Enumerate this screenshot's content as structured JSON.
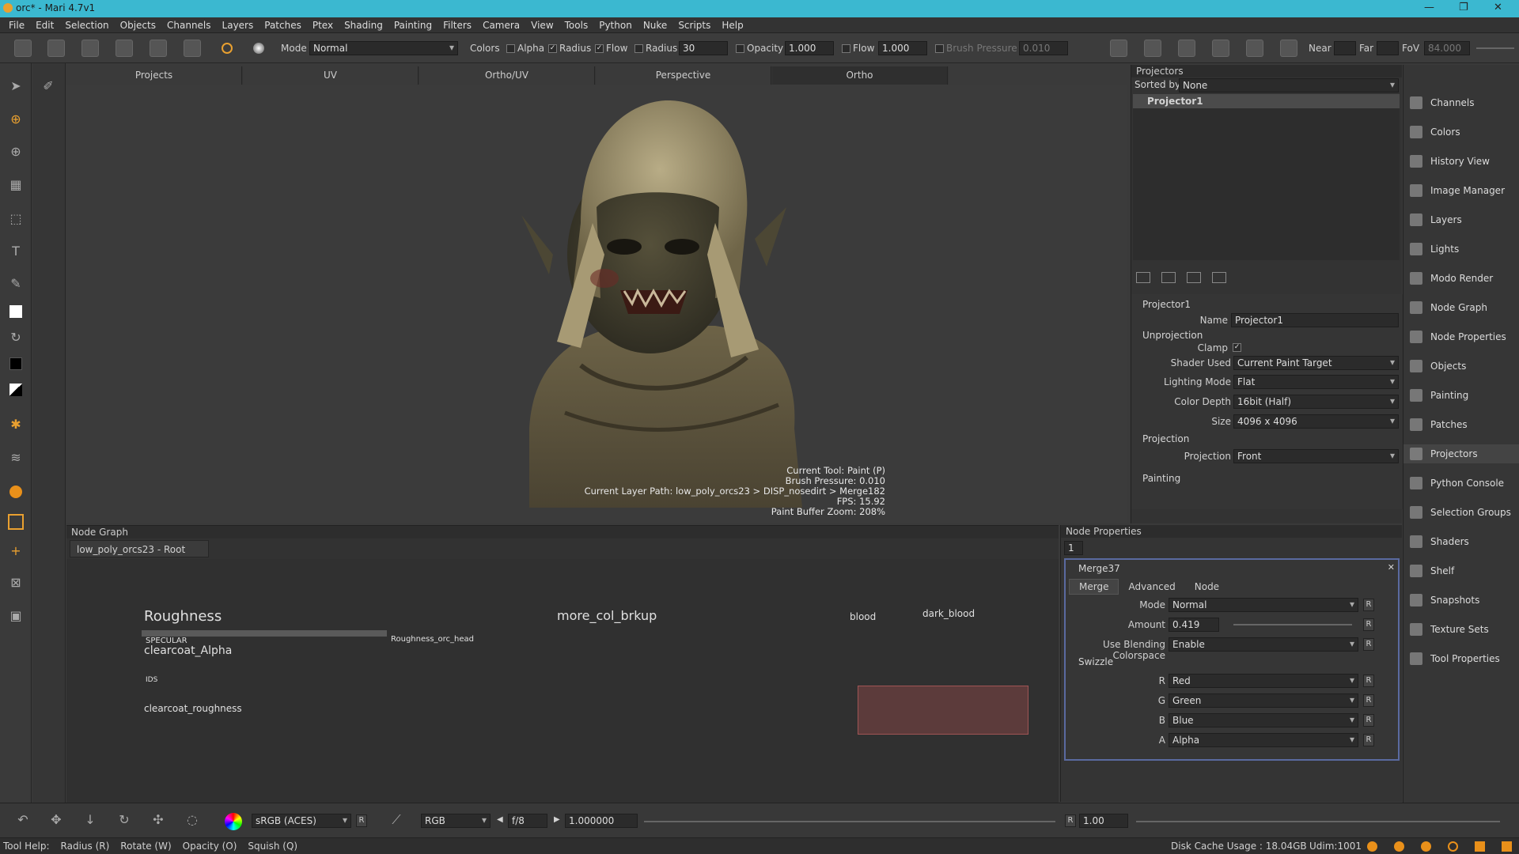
{
  "window": {
    "title": "orc* - Mari 4.7v1"
  },
  "menu": [
    "File",
    "Edit",
    "Selection",
    "Objects",
    "Channels",
    "Layers",
    "Patches",
    "Ptex",
    "Shading",
    "Painting",
    "Filters",
    "Camera",
    "View",
    "Tools",
    "Python",
    "Nuke",
    "Scripts",
    "Help"
  ],
  "toolbar": {
    "mode_label": "Mode",
    "mode_value": "Normal",
    "colors_label": "Colors",
    "alpha_label": "Alpha",
    "radius_label": "Radius",
    "flow_label": "Flow",
    "radius2_label": "Radius",
    "radius_value": "30",
    "opacity_label": "Opacity",
    "opacity_value": "1.000",
    "flow2_label": "Flow",
    "flow_value": "1.000",
    "brush_pressure_label": "Brush Pressure",
    "brush_pressure_value": "0.010",
    "near_label": "Near",
    "far_label": "Far",
    "fov_label": "FoV",
    "fov_value": "84.000"
  },
  "view_tabs": [
    "Projects",
    "UV",
    "Ortho/UV",
    "Perspective",
    "Ortho"
  ],
  "hud": {
    "tool": "Current Tool: Paint (P)",
    "pressure": "Brush Pressure: 0.010",
    "layer_path": "Current Layer Path: low_poly_orcs23 > DISP_nosedirt > Merge182",
    "fps": "FPS: 15.92",
    "zoom": "Paint Buffer Zoom: 208%"
  },
  "projectors": {
    "title": "Projectors",
    "sorted_by_label": "Sorted by",
    "sorted_by_value": "None",
    "item": "Projector1",
    "section": "Projector1",
    "name_label": "Name",
    "name_value": "Projector1",
    "unprojection": "Unprojection",
    "clamp_label": "Clamp",
    "shader_label": "Shader Used",
    "shader_value": "Current Paint Target",
    "lighting_label": "Lighting Mode",
    "lighting_value": "Flat",
    "depth_label": "Color Depth",
    "depth_value": "16bit (Half)",
    "size_label": "Size",
    "size_value": "4096 x 4096",
    "projection": "Projection",
    "projection_label": "Projection",
    "projection_value": "Front",
    "painting": "Painting"
  },
  "palettes": [
    "Channels",
    "Colors",
    "History View",
    "Image Manager",
    "Layers",
    "Lights",
    "Modo Render",
    "Node Graph",
    "Node Properties",
    "Objects",
    "Painting",
    "Patches",
    "Projectors",
    "Python Console",
    "Selection Groups",
    "Shaders",
    "Shelf",
    "Snapshots",
    "Texture Sets",
    "Tool Properties"
  ],
  "nodegraph": {
    "title": "Node Graph",
    "tab": "low_poly_orcs23 - Root",
    "labels": [
      "Roughness",
      "SPECULAR",
      "clearcoat_Alpha",
      "IDS",
      "clearcoat_roughness",
      "more_col_brkup",
      "Roughness_orc_head",
      "blood",
      "dark_blood"
    ]
  },
  "nodeprops": {
    "title": "Node Properties",
    "count": "1",
    "node": "Merge37",
    "tabs": [
      "Merge",
      "Advanced",
      "Node"
    ],
    "mode_label": "Mode",
    "mode_value": "Normal",
    "amount_label": "Amount",
    "amount_value": "0.419",
    "blend_label": "Use Blending Colorspace",
    "blend_value": "Enable",
    "swizzle": "Swizzle",
    "r_label": "R",
    "r_value": "Red",
    "g_label": "G",
    "g_value": "Green",
    "b_label": "B",
    "b_value": "Blue",
    "a_label": "A",
    "a_value": "Alpha"
  },
  "bottombar": {
    "colorspace": "sRGB (ACES)",
    "r": "R",
    "channel": "RGB",
    "fstop": "f/8",
    "gain": "1.000000",
    "r2": "R",
    "gamma": "1.00"
  },
  "status": {
    "tool_help": "Tool Help:",
    "hints": [
      "Radius (R)",
      "Rotate (W)",
      "Opacity (O)",
      "Squish (Q)"
    ],
    "disk": "Disk Cache Usage : 18.04GB",
    "udim": "Udim:1001"
  }
}
